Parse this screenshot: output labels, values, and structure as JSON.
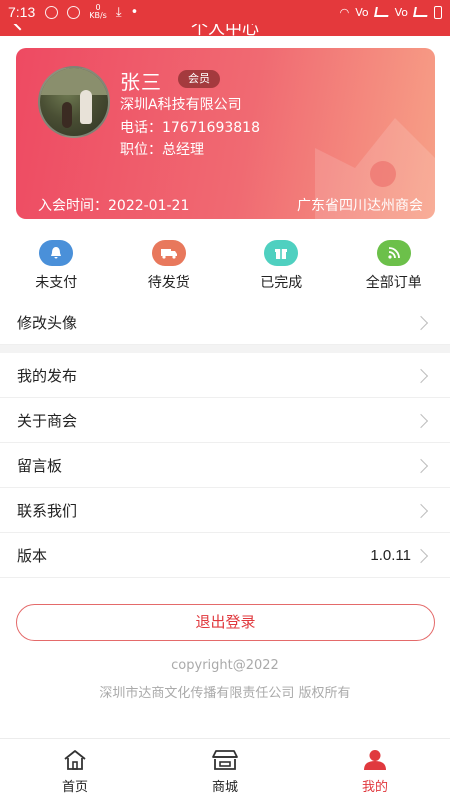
{
  "status_bar": {
    "time": "7:13",
    "net_speed": "0\nKB/s",
    "right_text_1": "Vo",
    "right_text_2": "Vo"
  },
  "header": {
    "title": "个人中心"
  },
  "profile": {
    "name": "张三",
    "badge": "会员",
    "company": "深圳A科技有限公司",
    "phone": "电话：17671693818",
    "position": "职位：总经理",
    "join_date": "入会时间：2022-01-21",
    "chamber": "广东省四川达州商会"
  },
  "orders": [
    {
      "label": "未支付",
      "icon": "bell-icon",
      "color": "#4a90d9"
    },
    {
      "label": "待发货",
      "icon": "truck-icon",
      "color": "#e8785c"
    },
    {
      "label": "已完成",
      "icon": "gift-icon",
      "color": "#4fd0c0"
    },
    {
      "label": "全部订单",
      "icon": "rss-icon",
      "color": "#6cc04a"
    }
  ],
  "menu": {
    "change_avatar": "修改头像",
    "my_posts": "我的发布",
    "about": "关于商会",
    "message_board": "留言板",
    "contact": "联系我们",
    "version_label": "版本",
    "version_value": "1.0.11"
  },
  "logout": "退出登录",
  "footer": {
    "copyright": "copyright@2022",
    "rights": "深圳市达商文化传播有限责任公司 版权所有"
  },
  "nav": [
    {
      "label": "首页",
      "icon": "home-icon"
    },
    {
      "label": "商城",
      "icon": "store-icon"
    },
    {
      "label": "我的",
      "icon": "user-icon",
      "active": true
    }
  ],
  "colors": {
    "brand": "#e4393c",
    "accent_text": "#e0393e"
  }
}
